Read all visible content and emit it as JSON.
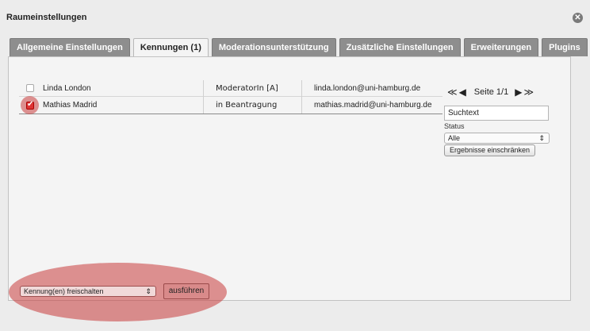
{
  "dialog": {
    "title": "Raumeinstellungen",
    "close_symbol": "✕"
  },
  "tabs": [
    {
      "label": "Allgemeine Einstellungen",
      "active": false
    },
    {
      "label": "Kennungen (1)",
      "active": true
    },
    {
      "label": "Moderationsunterstützung",
      "active": false
    },
    {
      "label": "Zusätzliche Einstellungen",
      "active": false
    },
    {
      "label": "Erweiterungen",
      "active": false
    },
    {
      "label": "Plugins",
      "active": false
    }
  ],
  "users": [
    {
      "name": "Linda London",
      "role": "ModeratorIn [A]",
      "email": "linda.london@uni-hamburg.de",
      "checked": false
    },
    {
      "name": "Mathias Madrid",
      "role": "in Beantragung",
      "email": "mathias.madrid@uni-hamburg.de",
      "checked": true
    }
  ],
  "pager": {
    "first": "≪",
    "prev": "◀",
    "label": "Seite 1/1",
    "next": "▶",
    "last": "≫"
  },
  "search": {
    "value": "Suchtext"
  },
  "status": {
    "label": "Status",
    "selected": "Alle",
    "caret": "⇕"
  },
  "filter_button": "Ergebnisse einschränken",
  "action": {
    "selected": "Kennung(en) freischalten",
    "caret": "⇕",
    "run_label": "ausführen"
  },
  "colors": {
    "highlight": "#c83c3c",
    "tab_inactive": "#8e8e8e",
    "checkbox_checked": "#dd3333"
  }
}
